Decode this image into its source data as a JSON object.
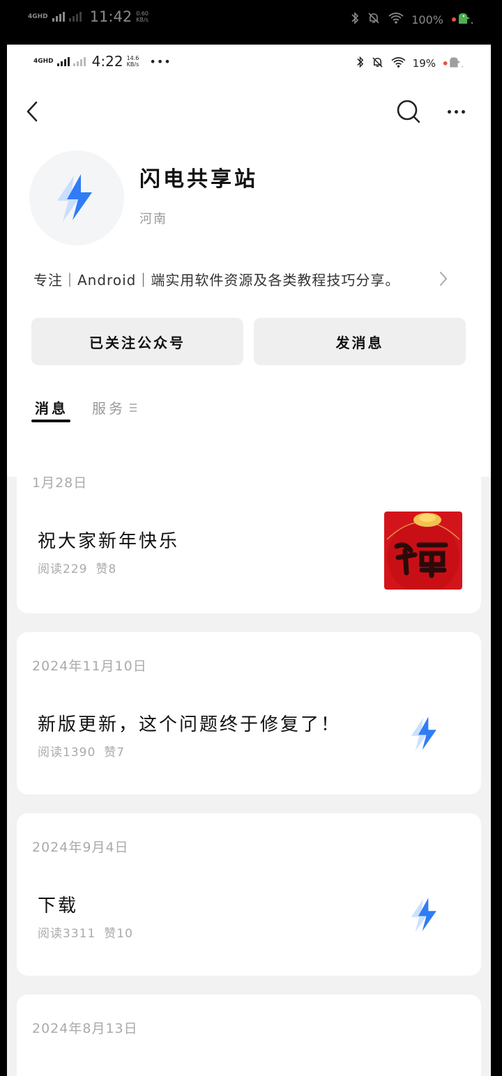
{
  "outer_status": {
    "network": "4GHD",
    "time": "11:42",
    "speed_value": "0.60",
    "speed_unit": "KB/s",
    "battery": "100%"
  },
  "inner_status": {
    "network": "4GHD",
    "time": "4:22",
    "speed_value": "14.6",
    "speed_unit": "KB/s",
    "battery": "19%"
  },
  "account": {
    "name": "闪电共享站",
    "location": "河南",
    "description": "专注｜Android｜端实用软件资源及各类教程技巧分享。"
  },
  "actions": {
    "follow_label": "已关注公众号",
    "message_label": "发消息"
  },
  "tabs": {
    "messages": "消息",
    "services": "服务"
  },
  "posts": [
    {
      "date": "1月28日",
      "title": "祝大家新年快乐",
      "reads": "阅读229",
      "likes": "赞8",
      "thumb": "fu-image"
    },
    {
      "date": "2024年11月10日",
      "title": "新版更新，这个问题终于修复了！",
      "reads": "阅读1390",
      "likes": "赞7",
      "thumb": "bolt-logo"
    },
    {
      "date": "2024年9月4日",
      "title": "下载",
      "reads": "阅读3311",
      "likes": "赞10",
      "thumb": "bolt-logo"
    },
    {
      "date": "2024年8月13日",
      "title": "",
      "reads": "",
      "likes": "",
      "thumb": ""
    }
  ],
  "colors": {
    "bolt_blue": "#2f7cf6",
    "bolt_light": "#bcd6ff",
    "fu_red": "#d4141b"
  }
}
